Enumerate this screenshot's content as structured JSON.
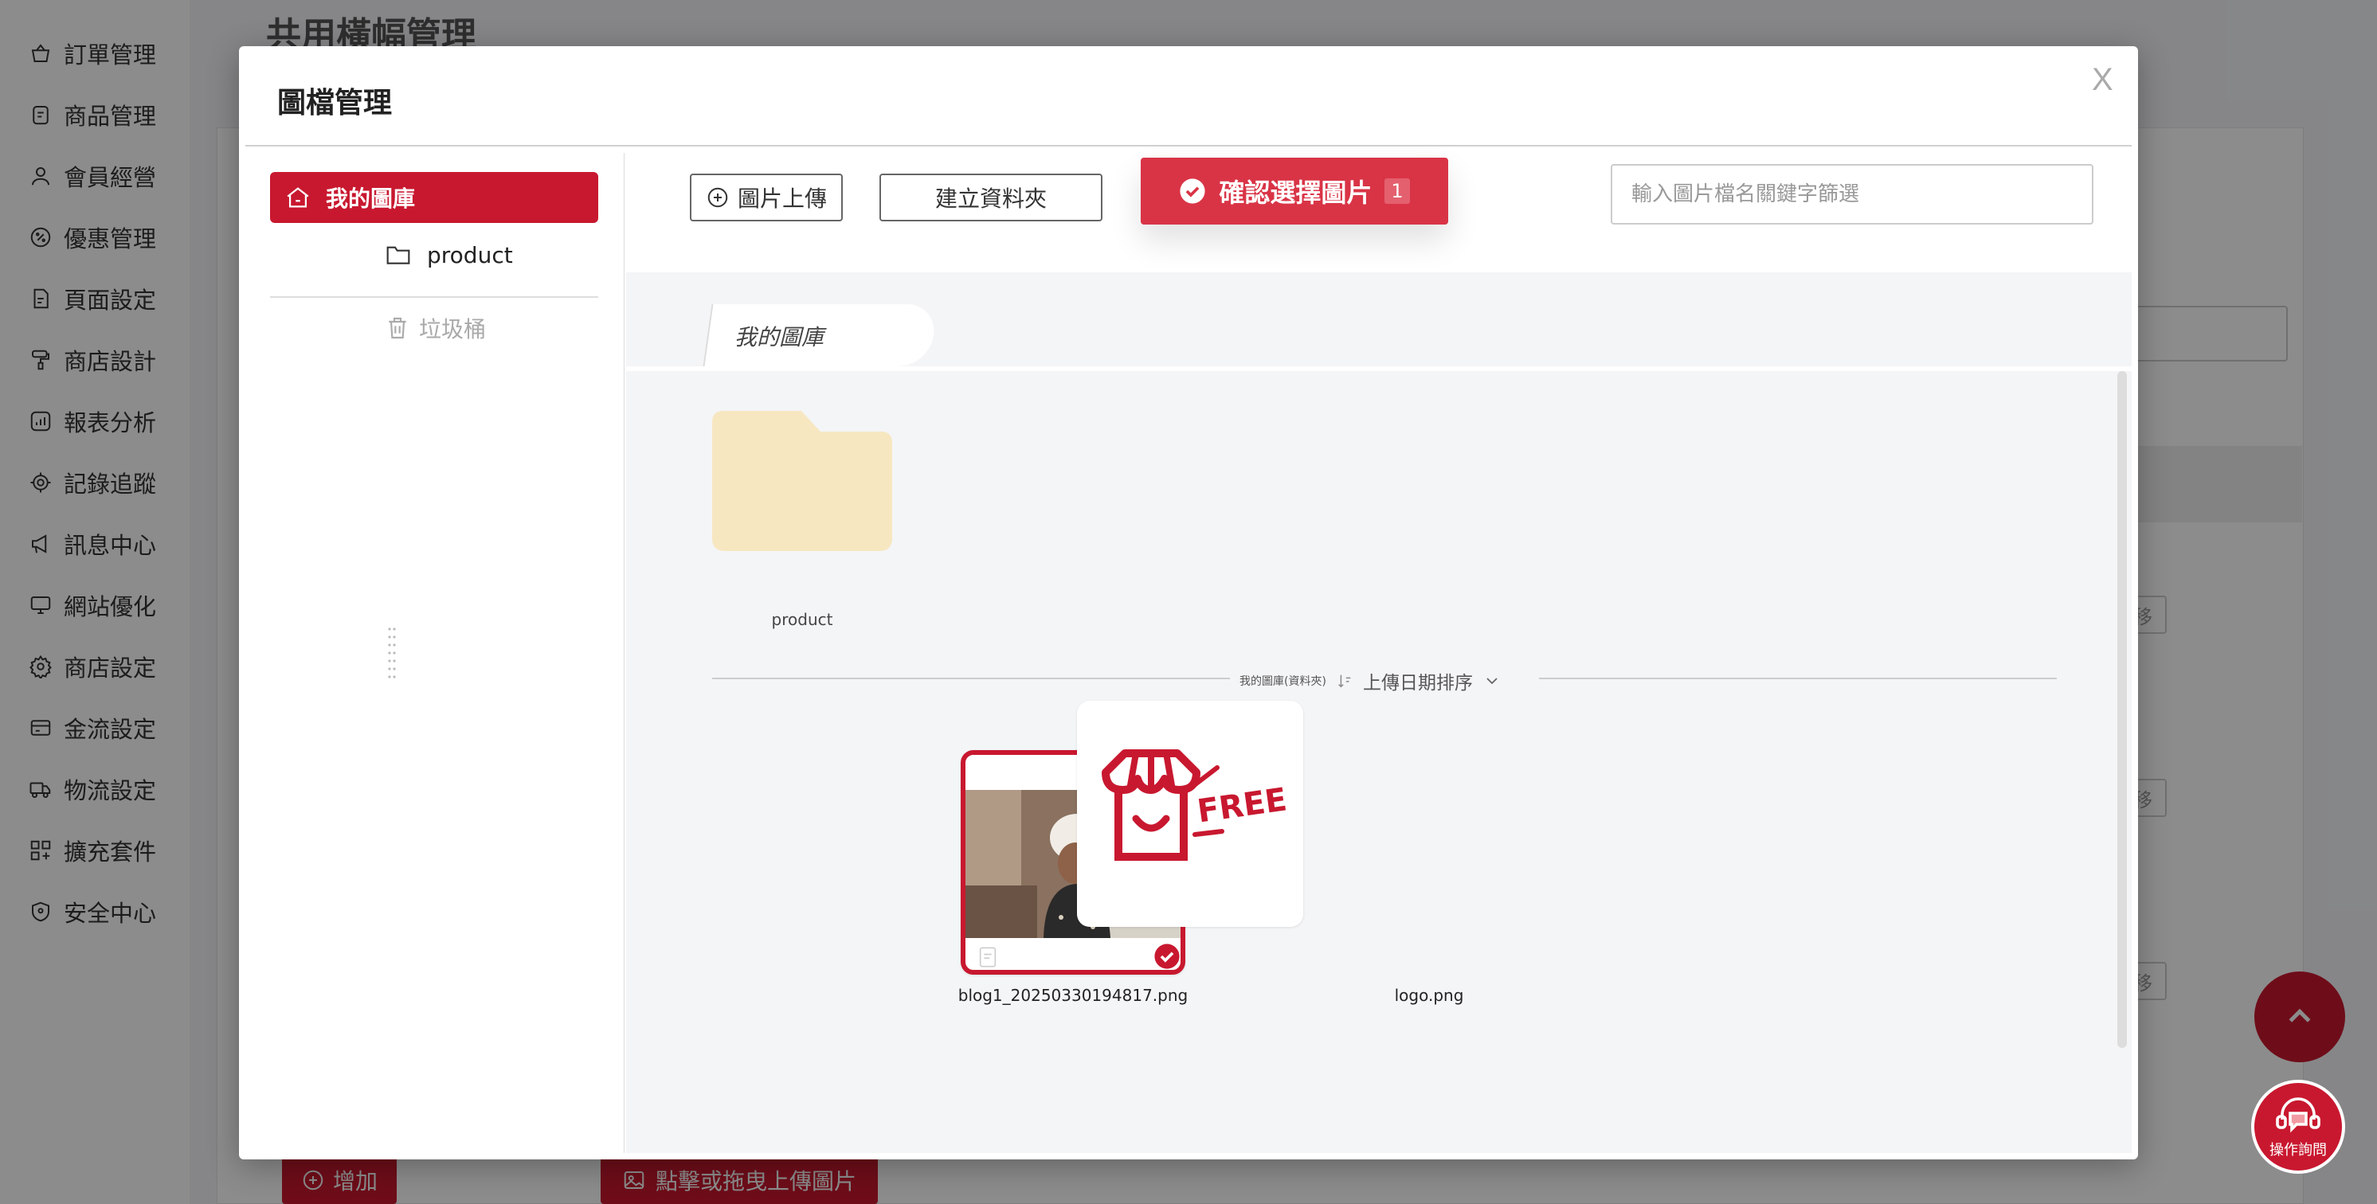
{
  "sidebar": {
    "items": [
      {
        "label": "訂單管理",
        "icon": "basket-icon"
      },
      {
        "label": "商品管理",
        "icon": "clipboard-icon"
      },
      {
        "label": "會員經營",
        "icon": "user-icon"
      },
      {
        "label": "優惠管理",
        "icon": "discount-icon"
      },
      {
        "label": "頁面設定",
        "icon": "page-icon"
      },
      {
        "label": "商店設計",
        "icon": "paint-roller-icon"
      },
      {
        "label": "報表分析",
        "icon": "chart-icon"
      },
      {
        "label": "記錄追蹤",
        "icon": "target-icon"
      },
      {
        "label": "訊息中心",
        "icon": "megaphone-icon"
      },
      {
        "label": "網站優化",
        "icon": "monitor-icon"
      },
      {
        "label": "商店設定",
        "icon": "gear-icon"
      },
      {
        "label": "金流設定",
        "icon": "card-icon"
      },
      {
        "label": "物流設定",
        "icon": "truck-icon"
      },
      {
        "label": "擴充套件",
        "icon": "apps-plus-icon"
      },
      {
        "label": "安全中心",
        "icon": "shield-icon"
      }
    ]
  },
  "background_page": {
    "title": "共用橫幅管理",
    "add_label": "增加",
    "upload_label": "點擊或拖曳上傳圖片",
    "move_label": "移"
  },
  "modal": {
    "title": "圖檔管理",
    "close_label": "X",
    "tree": {
      "root_label": "我的圖庫",
      "child_label": "product",
      "trash_label": "垃圾桶"
    },
    "toolbar": {
      "upload_label": "圖片上傳",
      "new_folder_label": "建立資料夾",
      "confirm_label": "確認選擇圖片",
      "confirm_count": "1",
      "search_placeholder": "輸入圖片檔名關鍵字篩選"
    },
    "breadcrumb": "我的圖庫",
    "folders": [
      {
        "name": "product"
      }
    ],
    "section": {
      "label": "我的圖庫(資料夾)",
      "sort_label": "上傳日期排序"
    },
    "images": [
      {
        "name": "blog1_20250330194817.png",
        "selected": true
      },
      {
        "name": "logo.png",
        "selected": false,
        "logo_text": "FREE"
      }
    ]
  },
  "help": {
    "label": "操作詢問"
  },
  "colors": {
    "brand": "#c8182f",
    "confirm": "#d93446",
    "folder": "#f7e7c1"
  }
}
